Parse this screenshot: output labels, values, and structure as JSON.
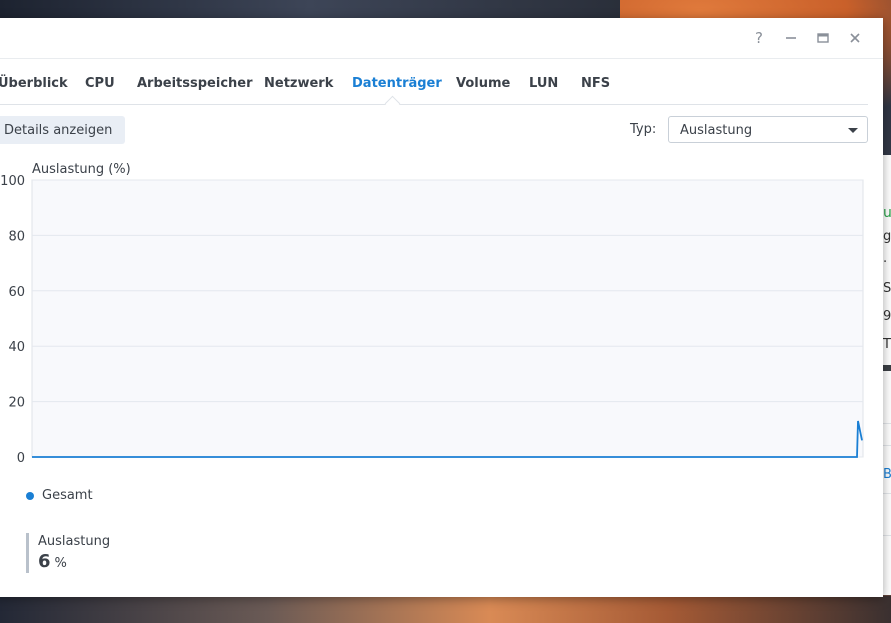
{
  "window": {
    "controls": {
      "help": "?",
      "minimize": "—",
      "maximize": "□",
      "close": "✕"
    }
  },
  "tabs": [
    {
      "label": "Überblick"
    },
    {
      "label": "CPU"
    },
    {
      "label": "Arbeitsspeicher"
    },
    {
      "label": "Netzwerk"
    },
    {
      "label": "Datenträger",
      "active": true
    },
    {
      "label": "Volume"
    },
    {
      "label": "LUN"
    },
    {
      "label": "NFS"
    }
  ],
  "toolbar": {
    "details_label": "Details anzeigen",
    "typ_label": "Typ:",
    "typ_value": "Auslastung"
  },
  "chart_data": {
    "type": "line",
    "title": "Auslastung (%)",
    "ylim": [
      0,
      100
    ],
    "yticks": [
      "100",
      "80",
      "60",
      "40",
      "20",
      "0"
    ],
    "grid": true,
    "series": [
      {
        "name": "Gesamt",
        "color": "#1a7fd4",
        "values": [
          0,
          0,
          0,
          0,
          0,
          0,
          0,
          0,
          13,
          6
        ]
      }
    ]
  },
  "legend": {
    "label": "Gesamt",
    "color": "#1a7fd4"
  },
  "metric": {
    "label": "Auslastung",
    "value": "6",
    "unit": "%"
  },
  "background_app": {
    "fragments": [
      "u",
      "g",
      ".",
      "S",
      "9",
      "T",
      "B/"
    ]
  },
  "colors": {
    "accent": "#1a7fd4",
    "text": "#3b4149"
  }
}
